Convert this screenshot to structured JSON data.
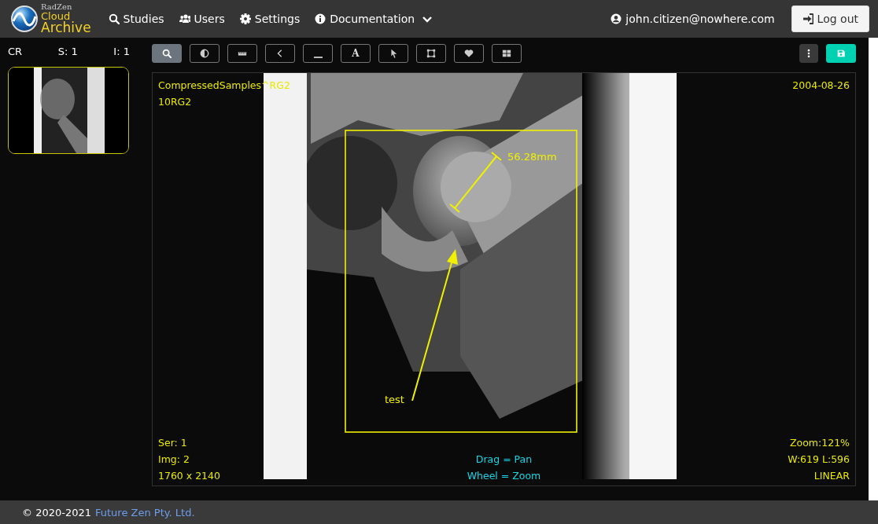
{
  "header": {
    "logo": {
      "brand": "RadZen",
      "line_1": "Cloud",
      "line_2": "Archive"
    },
    "nav": [
      {
        "label": "Studies",
        "kind": "studies",
        "dropdown": false
      },
      {
        "label": "Users",
        "kind": "users",
        "dropdown": false
      },
      {
        "label": "Settings",
        "kind": "settings",
        "dropdown": false
      },
      {
        "label": "Documentation",
        "kind": "documentation",
        "dropdown": true
      }
    ],
    "user": "john.citizen@nowhere.com",
    "logout": "Log out"
  },
  "series_panel": {
    "modality": "CR",
    "series": "S: 1",
    "images": "I: 1",
    "thumbnails": [
      {
        "selected": true
      }
    ]
  },
  "toolbar": {
    "tools": [
      {
        "kind": "zoom",
        "selected": true
      },
      {
        "kind": "contrast",
        "selected": false
      },
      {
        "kind": "ruler",
        "selected": false
      },
      {
        "kind": "angle",
        "selected": false
      },
      {
        "kind": "line",
        "selected": false
      },
      {
        "kind": "text",
        "label": "A",
        "selected": false
      },
      {
        "kind": "pointer",
        "selected": false
      },
      {
        "kind": "rectangle",
        "selected": false
      },
      {
        "kind": "heart",
        "selected": false
      },
      {
        "kind": "grid",
        "selected": false
      }
    ],
    "actions": [
      {
        "kind": "menu"
      },
      {
        "kind": "save"
      }
    ]
  },
  "viewer": {
    "top_left": [
      "CompressedSamples^RG2",
      "10RG2"
    ],
    "top_right": [
      "2004-08-26"
    ],
    "bottom_left": [
      "Ser: 1",
      "Img: 2",
      "1760 x 2140"
    ],
    "bottom_center": [
      "Drag = Pan",
      "Wheel = Zoom"
    ],
    "bottom_right": [
      "Zoom:121%",
      "W:619 L:596",
      "LINEAR"
    ],
    "annotations": [
      {
        "kind": "rectangle"
      },
      {
        "kind": "length",
        "label": "56.28mm"
      },
      {
        "kind": "arrow",
        "label": "test"
      }
    ]
  },
  "footer": {
    "copyright": "© 2020-2021",
    "link": "Future Zen Pty. Ltd."
  }
}
